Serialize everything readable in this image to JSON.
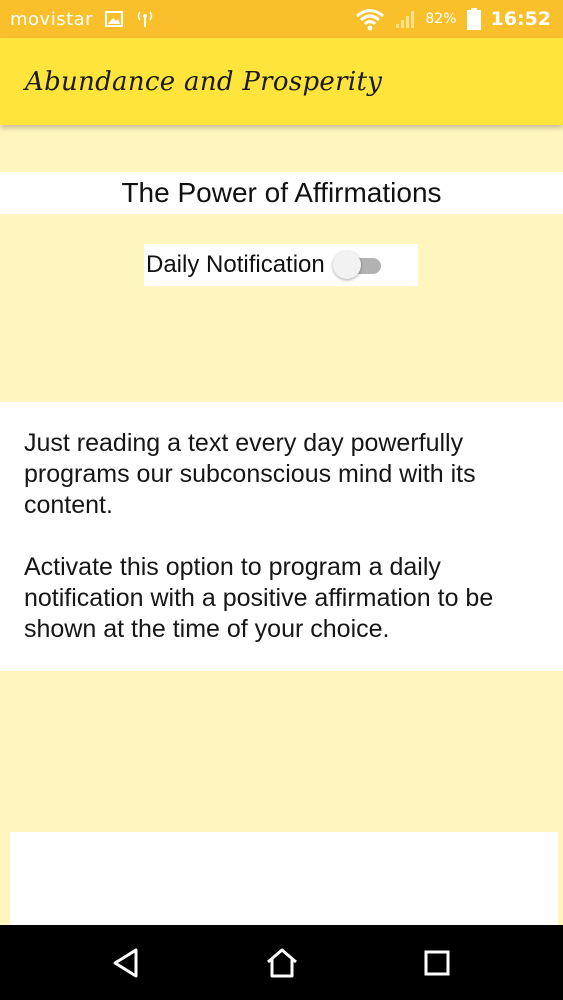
{
  "status_bar": {
    "carrier": "movistar",
    "battery_percent": "82%",
    "time": "16:52",
    "icons": [
      "image-icon",
      "hotspot-icon",
      "wifi-icon",
      "cell-signal-icon",
      "battery-icon"
    ]
  },
  "app_bar": {
    "title": "Abundance and Prosperity"
  },
  "content": {
    "section_title": "The Power of Affirmations",
    "toggle": {
      "label": "Daily Notification",
      "checked": false
    },
    "paragraphs": [
      "Just reading a text every day powerfully programs our subconscious mind with its content.",
      "Activate this option to program a daily notification with a positive affirmation to be shown at the time of your choice."
    ]
  },
  "nav_bar": {
    "icons": [
      "back-icon",
      "home-icon",
      "recents-icon"
    ]
  },
  "colors": {
    "status_bar": "#F9C02B",
    "app_bar": "#FFE43B",
    "background": "#FFF6BF",
    "card": "#FFFFFF",
    "nav_bar": "#000000"
  }
}
